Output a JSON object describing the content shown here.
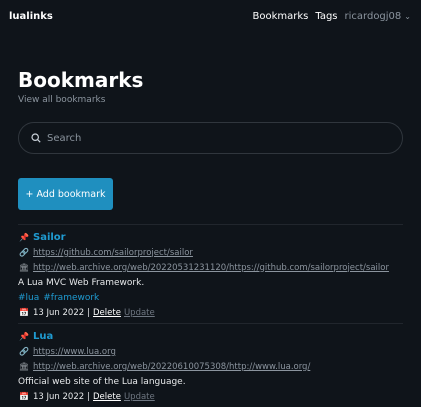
{
  "app": {
    "brand": "lualinks"
  },
  "nav": {
    "bookmarks": "Bookmarks",
    "tags": "Tags",
    "user": "ricardogj08",
    "chevron": "⌄"
  },
  "page": {
    "title": "Bookmarks",
    "subtitle": "View all bookmarks"
  },
  "search": {
    "placeholder": "Search"
  },
  "add_button": {
    "label": "+ Add bookmark"
  },
  "bookmarks": [
    {
      "title": "Sailor",
      "url": "https://github.com/sailorproject/sailor",
      "archive": "http://web.archive.org/web/20220531231120/https://github.com/sailorproject/sailor",
      "description": "A Lua MVC Web Framework.",
      "tags": [
        "#lua",
        "#framework"
      ],
      "date": "13 Jun 2022",
      "delete": "Delete",
      "update": "Update"
    },
    {
      "title": "Lua",
      "url": "https://www.lua.org",
      "archive": "http://web.archive.org/web/20220610075308/http://www.lua.org/",
      "description": "Official web site of the Lua language.",
      "tags": [],
      "date": "13 Jun 2022",
      "delete": "Delete",
      "update": "Update"
    }
  ],
  "icons": {
    "pin": "pin-icon",
    "link": "link-icon",
    "archive": "archive-icon",
    "calendar": "calendar-icon",
    "search": "search-icon"
  },
  "colors": {
    "background": "#0f141a",
    "accent": "#1f8fbf",
    "link": "#1f9bd1",
    "muted": "#8b949e"
  }
}
